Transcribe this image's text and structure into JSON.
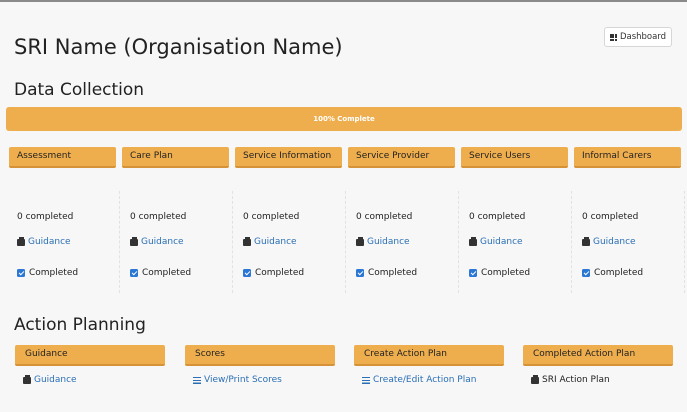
{
  "header": {
    "dashboard_label": "Dashboard",
    "title": "SRI Name (Organisation Name)"
  },
  "data_collection": {
    "section_title": "Data Collection",
    "progress_label": "100% Complete",
    "progress_fraction": 1.0,
    "columns": [
      {
        "header": "Assessment",
        "count": "0 completed",
        "guidance": "Guidance",
        "status": "Completed"
      },
      {
        "header": "Care Plan",
        "count": "0 completed",
        "guidance": "Guidance",
        "status": "Completed"
      },
      {
        "header": "Service Information",
        "count": "0 completed",
        "guidance": "Guidance",
        "status": "Completed"
      },
      {
        "header": "Service Provider",
        "count": "0 completed",
        "guidance": "Guidance",
        "status": "Completed"
      },
      {
        "header": "Service Users",
        "count": "0 completed",
        "guidance": "Guidance",
        "status": "Completed"
      },
      {
        "header": "Informal Carers",
        "count": "0 completed",
        "guidance": "Guidance",
        "status": "Completed"
      }
    ]
  },
  "action_planning": {
    "section_title": "Action Planning",
    "columns": [
      {
        "header": "Guidance",
        "link": "Guidance",
        "icon": "print-icon"
      },
      {
        "header": "Scores",
        "link": "View/Print Scores",
        "icon": "list-icon"
      },
      {
        "header": "Create Action Plan",
        "link": "Create/Edit Action Plan",
        "icon": "list-icon"
      },
      {
        "header": "Completed Action Plan",
        "link": "SRI Action Plan",
        "icon": "print-icon"
      }
    ]
  },
  "colors": {
    "accent": "#efae4e",
    "link": "#2a6fb5",
    "check": "#2a77d6"
  }
}
